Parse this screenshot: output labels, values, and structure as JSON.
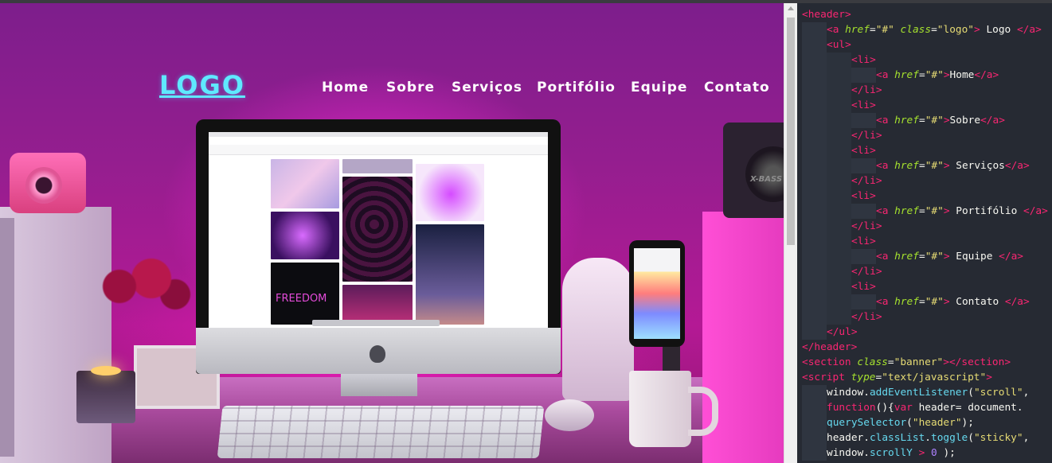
{
  "preview": {
    "logo": "LOGO",
    "nav": [
      "Home",
      "Sobre",
      "Serviços",
      "Portifólio",
      "Equipe",
      "Contato"
    ],
    "screen_text": "FREEDOM",
    "speaker_text": "X-BASS",
    "colors": {
      "logo": "#5fe9ff",
      "nav_text": "#ffffff",
      "ambient_magenta": "#ff2ad8"
    }
  },
  "editor": {
    "colors": {
      "background": "#262a33",
      "tag": "#f92672",
      "attribute": "#a6e22e",
      "string": "#e6db74",
      "function": "#66d9ef",
      "number": "#ae81ff",
      "text": "#f8f8f2"
    },
    "lines": [
      {
        "i": 0,
        "t": "<header>"
      },
      {
        "i": 1,
        "t": "<a href=\"#\" class=\"logo\"> Logo </a>"
      },
      {
        "i": 1,
        "t": "<ul>"
      },
      {
        "i": 2,
        "t": "<li>"
      },
      {
        "i": 3,
        "t": "<a href=\"#\">Home</a>"
      },
      {
        "i": 2,
        "t": "</li>"
      },
      {
        "i": 2,
        "t": "<li>"
      },
      {
        "i": 3,
        "t": "<a href=\"#\">Sobre</a>"
      },
      {
        "i": 2,
        "t": "</li>"
      },
      {
        "i": 2,
        "t": "<li>"
      },
      {
        "i": 3,
        "t": "<a href=\"#\"> Serviços</a>"
      },
      {
        "i": 2,
        "t": "</li>"
      },
      {
        "i": 2,
        "t": "<li>"
      },
      {
        "i": 3,
        "t": "<a href=\"#\"> Portifólio </a>"
      },
      {
        "i": 2,
        "t": "</li>"
      },
      {
        "i": 2,
        "t": "<li>"
      },
      {
        "i": 3,
        "t": "<a href=\"#\"> Equipe </a>"
      },
      {
        "i": 2,
        "t": "</li>"
      },
      {
        "i": 2,
        "t": "<li>"
      },
      {
        "i": 3,
        "t": "<a href=\"#\"> Contato </a>"
      },
      {
        "i": 2,
        "t": "</li>"
      },
      {
        "i": 1,
        "t": "</ul>"
      },
      {
        "i": 0,
        "t": "</header>"
      },
      {
        "i": 0,
        "t": "<section class=\"banner\"></section>"
      },
      {
        "i": 0,
        "t": "<script type=\"text/javascript\">"
      },
      {
        "i": 1,
        "t": "window.addEventListener(\"scroll\","
      },
      {
        "i": 1,
        "t": "function(){var header= document."
      },
      {
        "i": 1,
        "t": "querySelector(\"header\");"
      },
      {
        "i": 1,
        "t": "header.classList.toggle(\"sticky\","
      },
      {
        "i": 1,
        "t": "window.scrollY > 0 );"
      }
    ]
  }
}
